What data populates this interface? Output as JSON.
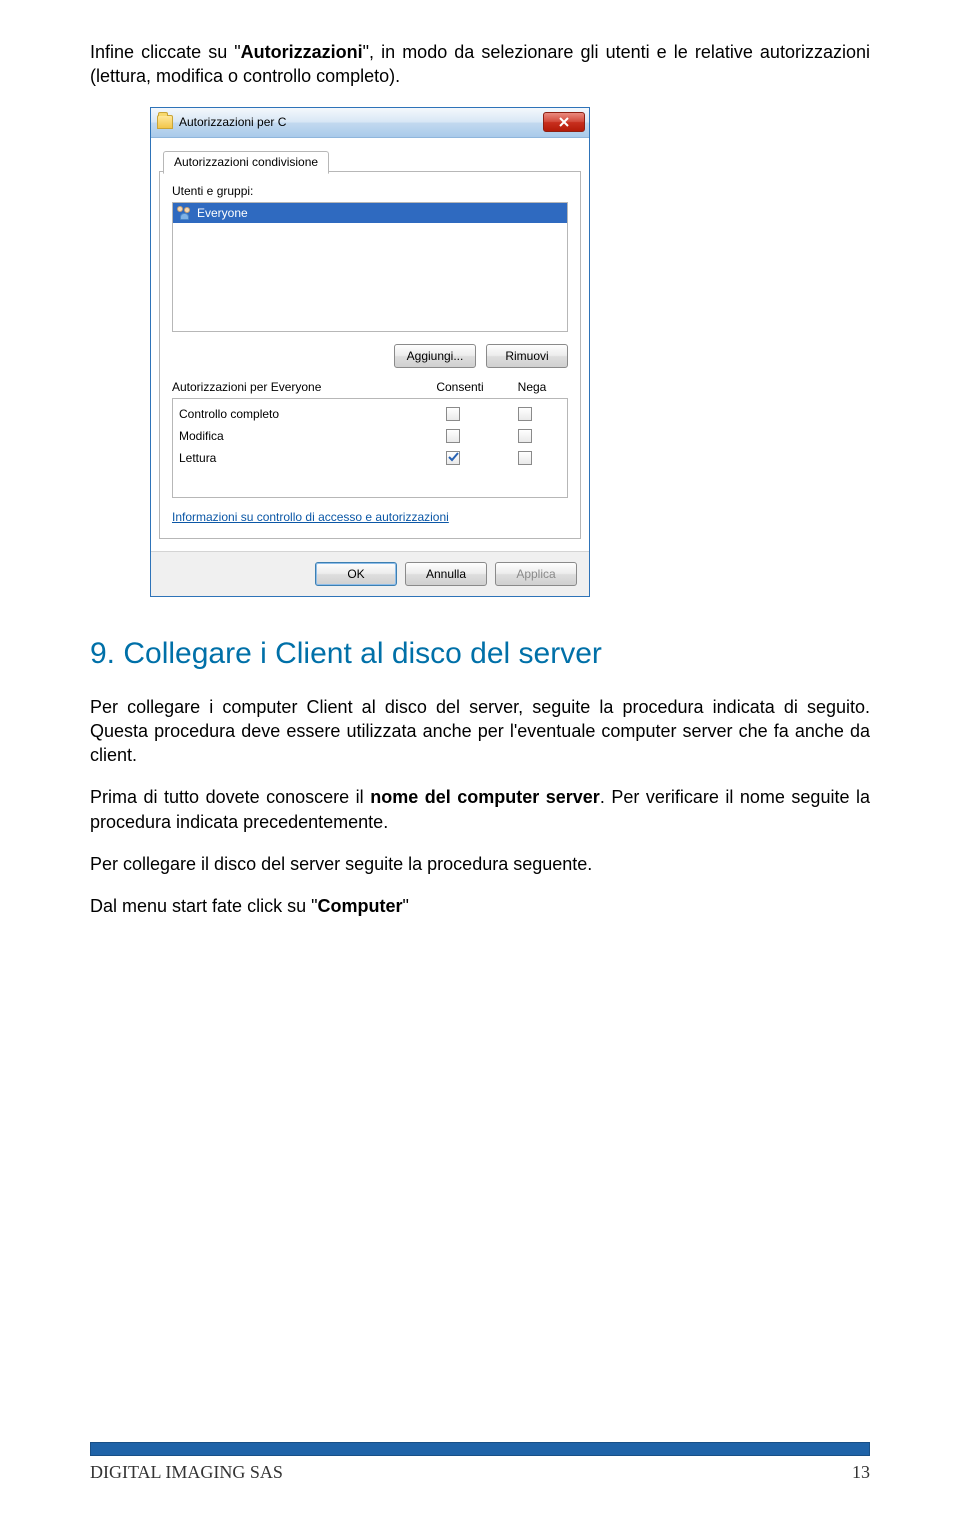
{
  "intro": {
    "p1a": "Infine cliccate su \"",
    "p1b": "Autorizzazioni",
    "p1c": "\", in modo da selezionare gli utenti e le relative autorizzazioni (lettura, modifica o controllo completo)."
  },
  "dialog": {
    "title": "Autorizzazioni per C",
    "tab": "Autorizzazioni condivisione",
    "users_label": "Utenti e gruppi:",
    "users": [
      {
        "name": "Everyone",
        "selected": true
      }
    ],
    "add_btn": "Aggiungi...",
    "remove_btn": "Rimuovi",
    "perm_label": "Autorizzazioni per Everyone",
    "col_allow": "Consenti",
    "col_deny": "Nega",
    "rows": [
      {
        "label": "Controllo completo",
        "allow": false,
        "deny": false
      },
      {
        "label": "Modifica",
        "allow": false,
        "deny": false
      },
      {
        "label": "Lettura",
        "allow": true,
        "deny": false
      }
    ],
    "info_link": "Informazioni su controllo di accesso e autorizzazioni",
    "ok": "OK",
    "cancel": "Annulla",
    "apply": "Applica"
  },
  "section": {
    "heading": "9. Collegare i Client al disco del server",
    "p1": "Per collegare i computer Client al disco del server, seguite la procedura indicata di seguito. Questa procedura deve essere utilizzata anche per l'eventuale computer server che fa anche da client.",
    "p2a": "Prima di tutto dovete conoscere il ",
    "p2b": "nome del computer server",
    "p2c": ". Per verificare il nome seguite la procedura indicata precedentemente.",
    "p3": "Per collegare il disco del server seguite la procedura seguente.",
    "p4a": "Dal menu start fate click su \"",
    "p4b": "Computer",
    "p4c": "\""
  },
  "footer": {
    "left": "DIGITAL IMAGING SAS",
    "right": "13"
  }
}
